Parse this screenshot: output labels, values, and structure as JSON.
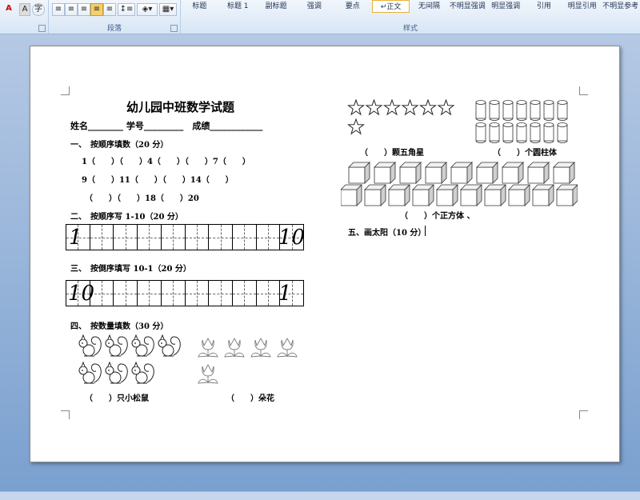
{
  "ribbon": {
    "font_group": {
      "font_color_glyph": "A",
      "shading_glyph": "A",
      "enclose_glyph": "字"
    },
    "paragraph_group": {
      "label": "段落"
    },
    "styles_group": {
      "label": "样式",
      "items": [
        "标题",
        "标题 1",
        "副标题",
        "强调",
        "要点",
        "正文",
        "无间隔",
        "不明显强调",
        "明显强调",
        "引用",
        "明显引用",
        "不明显参考"
      ],
      "selected_index": 5
    }
  },
  "document": {
    "title": "幼儿园中班数学试题",
    "info_line": "姓名________ 学号_________　成绩____________",
    "q1": {
      "heading": "一、　按顺序填数（20 分）",
      "rows": [
        "1（　　）（　　）4（　　）（　　）7（　　）",
        "9（　　）11（　　）（　　）14（　　）",
        "（　　）（　　）18（　　）20"
      ]
    },
    "q2": {
      "heading": "二、　按顺序写 1-10（20 分）",
      "start": "1",
      "end": "10"
    },
    "q3": {
      "heading": "三、　按倒序填写 10-1（20 分）",
      "start": "10",
      "end": "1"
    },
    "q4": {
      "heading": "四、　按数量填数（30 分）",
      "squirrel_count": 7,
      "flower_count": 5,
      "squirrel_answer": "（　　）只小松鼠",
      "flower_answer": "（　　）朵花"
    },
    "stars": {
      "count": 7,
      "answer": "（　　）颗五角星"
    },
    "cylinders": {
      "count": 14,
      "answer": "（　　）个圆柱体"
    },
    "cubes": {
      "count": 19,
      "answer": "（　　）个正方体 、"
    },
    "q5": {
      "heading": "五、画太阳（10 分）"
    }
  }
}
